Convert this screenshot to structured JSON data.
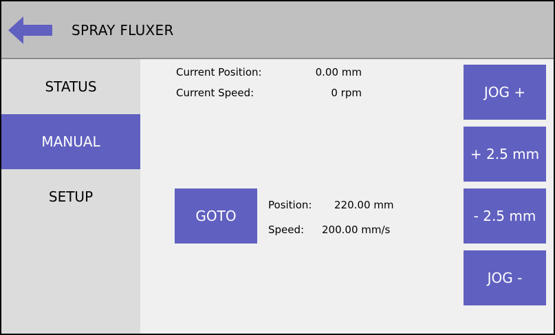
{
  "header": {
    "title": "SPRAY FLUXER",
    "back_icon": "arrow-left-icon"
  },
  "colors": {
    "accent": "#6060c0",
    "header_bg": "#c0c0c0",
    "sidebar_bg": "#dcdcdc",
    "content_bg": "#f0f0f0"
  },
  "sidebar": {
    "active": "MANUAL",
    "items": [
      {
        "label": "STATUS"
      },
      {
        "label": "MANUAL"
      },
      {
        "label": "SETUP"
      }
    ]
  },
  "current": {
    "position_label": "Current Position:",
    "position_value": "0.00 mm",
    "speed_label": "Current Speed:",
    "speed_value": "0 rpm"
  },
  "goto": {
    "button_label": "GOTO",
    "position_label": "Position:",
    "position_value": "220.00 mm",
    "speed_label": "Speed:",
    "speed_value": "200.00 mm/s"
  },
  "jog": {
    "jog_plus": "JOG +",
    "step_plus": "+ 2.5 mm",
    "step_minus": "- 2.5 mm",
    "jog_minus": "JOG -"
  }
}
